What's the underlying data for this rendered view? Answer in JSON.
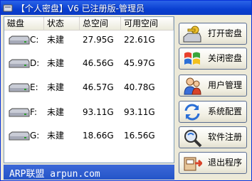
{
  "window": {
    "title": "【个人密盘】V6 已注册版-管理员"
  },
  "table": {
    "columns": [
      "磁盘",
      "状态",
      "总空间",
      "可用空间"
    ],
    "rows": [
      {
        "drive": "C:",
        "status": "未建",
        "total": "27.95G",
        "free": "22.61G"
      },
      {
        "drive": "D:",
        "status": "未建",
        "total": "46.56G",
        "free": "45.97G"
      },
      {
        "drive": "E:",
        "status": "未建",
        "total": "46.57G",
        "free": "40.78G"
      },
      {
        "drive": "F:",
        "status": "未建",
        "total": "93.11G",
        "free": "93.11G"
      },
      {
        "drive": "G:",
        "status": "未建",
        "total": "18.66G",
        "free": "16.56G"
      }
    ]
  },
  "buttons": {
    "open": "打开密盘",
    "close": "关闭密盘",
    "users": "用户管理",
    "config": "系统配置",
    "register": "软件注册",
    "exit": "退出程序"
  },
  "footer": {
    "text": "ARP联盟 arpun.com"
  },
  "icons": {
    "drive": "hard-drive-icon",
    "open": "key-disk-icon",
    "close": "windows-flag-icon",
    "users": "users-icon",
    "config": "sync-arrows-icon",
    "register": "magnifier-icon",
    "exit": "exit-door-icon"
  },
  "colors": {
    "titlebar": "#0a3fd1",
    "footer": "#2455c8"
  }
}
